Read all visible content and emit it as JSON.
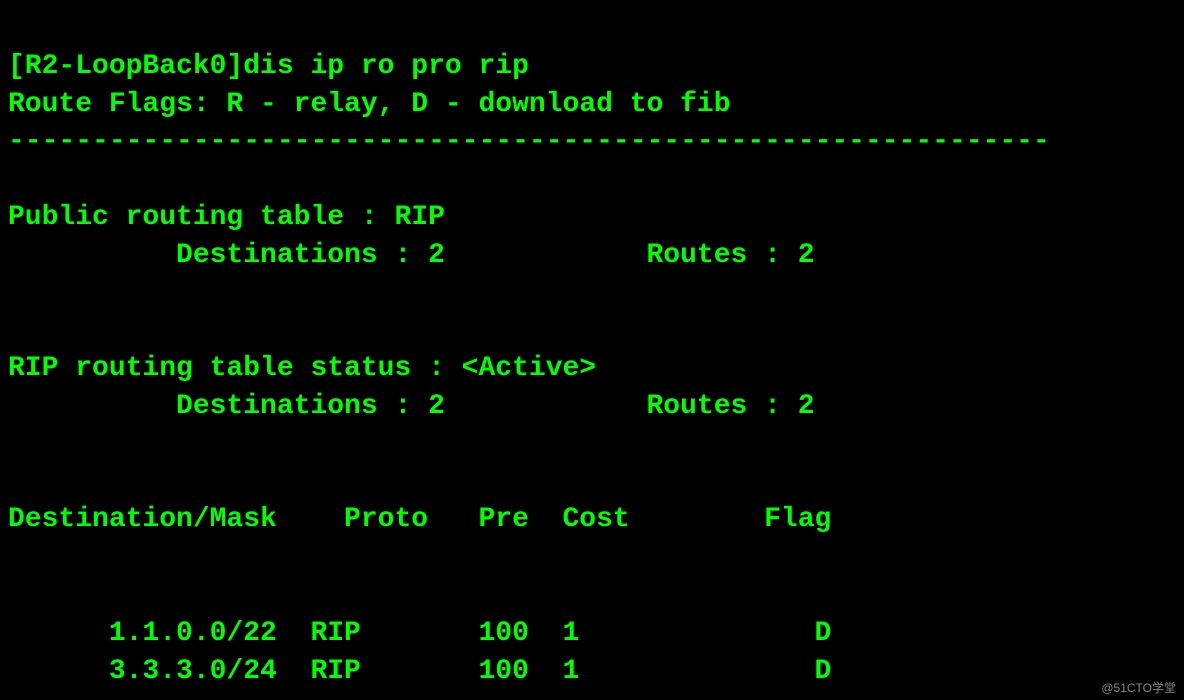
{
  "terminal": {
    "lines": [
      "[R2-LoopBack0]dis ip ro pro rip",
      "Route Flags: R - relay, D - download to fib",
      "--------------------------------------------------------------",
      "",
      "Public routing table : RIP",
      "          Destinations : 2            Routes : 2",
      "",
      "",
      "RIP routing table status : <Active>",
      "          Destinations : 2            Routes : 2",
      "",
      "",
      "Destination/Mask    Proto   Pre  Cost        Flag",
      "",
      "",
      "      1.1.0.0/22  RIP       100  1              D",
      "      3.3.3.0/24  RIP       100  1              D"
    ]
  },
  "watermark": {
    "text": "@51CTO学堂"
  }
}
